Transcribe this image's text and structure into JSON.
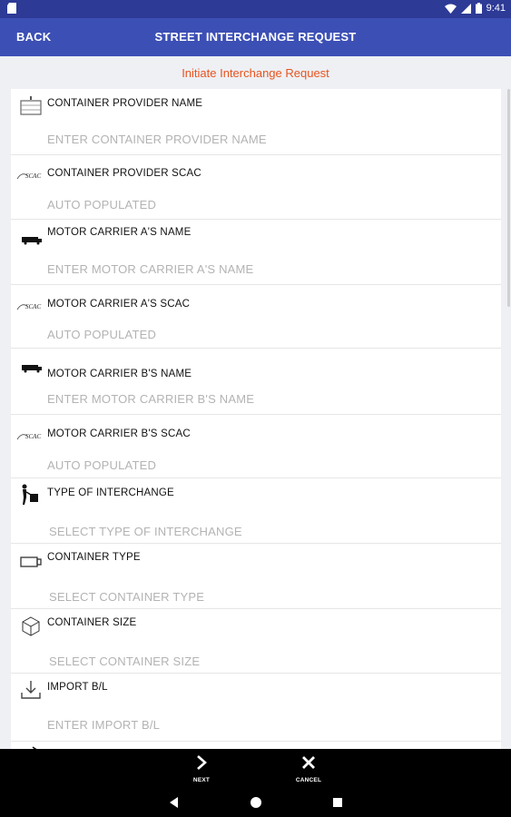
{
  "status_bar": {
    "time": "9:41"
  },
  "app_bar": {
    "back_label": "BACK",
    "title": "STREET INTERCHANGE REQUEST"
  },
  "subtitle": "Initiate Interchange Request",
  "fields": [
    {
      "icon": "container-icon",
      "label": "CONTAINER PROVIDER NAME",
      "placeholder": "ENTER CONTAINER PROVIDER NAME"
    },
    {
      "icon": "scac-icon",
      "label": "CONTAINER PROVIDER SCAC",
      "placeholder": "AUTO POPULATED"
    },
    {
      "icon": "truck-icon",
      "label": "MOTOR CARRIER A'S NAME",
      "placeholder": "ENTER MOTOR CARRIER A'S NAME"
    },
    {
      "icon": "scac-icon",
      "label": "MOTOR CARRIER A'S SCAC",
      "placeholder": "AUTO POPULATED"
    },
    {
      "icon": "truck-icon",
      "label": "MOTOR CARRIER B'S NAME",
      "placeholder": "ENTER MOTOR CARRIER B'S NAME"
    },
    {
      "icon": "scac-icon",
      "label": "MOTOR CARRIER B'S SCAC",
      "placeholder": "AUTO POPULATED"
    },
    {
      "icon": "handshake-icon",
      "label": "TYPE OF INTERCHANGE",
      "placeholder": "SELECT TYPE OF INTERCHANGE"
    },
    {
      "icon": "container-type-icon",
      "label": "CONTAINER TYPE",
      "placeholder": "SELECT CONTAINER TYPE"
    },
    {
      "icon": "cube-icon",
      "label": "CONTAINER SIZE",
      "placeholder": "SELECT CONTAINER SIZE"
    },
    {
      "icon": "download-icon",
      "label": "IMPORT B/L",
      "placeholder": "ENTER IMPORT B/L"
    }
  ],
  "scac_text": "SCAC",
  "bottom_bar": {
    "next_label": "NEXT",
    "cancel_label": "CANCEL"
  },
  "colors": {
    "status_bar": "#2d3a96",
    "app_bar": "#3c4fb5",
    "accent": "#e9531e",
    "placeholder": "#b3b3b3"
  }
}
